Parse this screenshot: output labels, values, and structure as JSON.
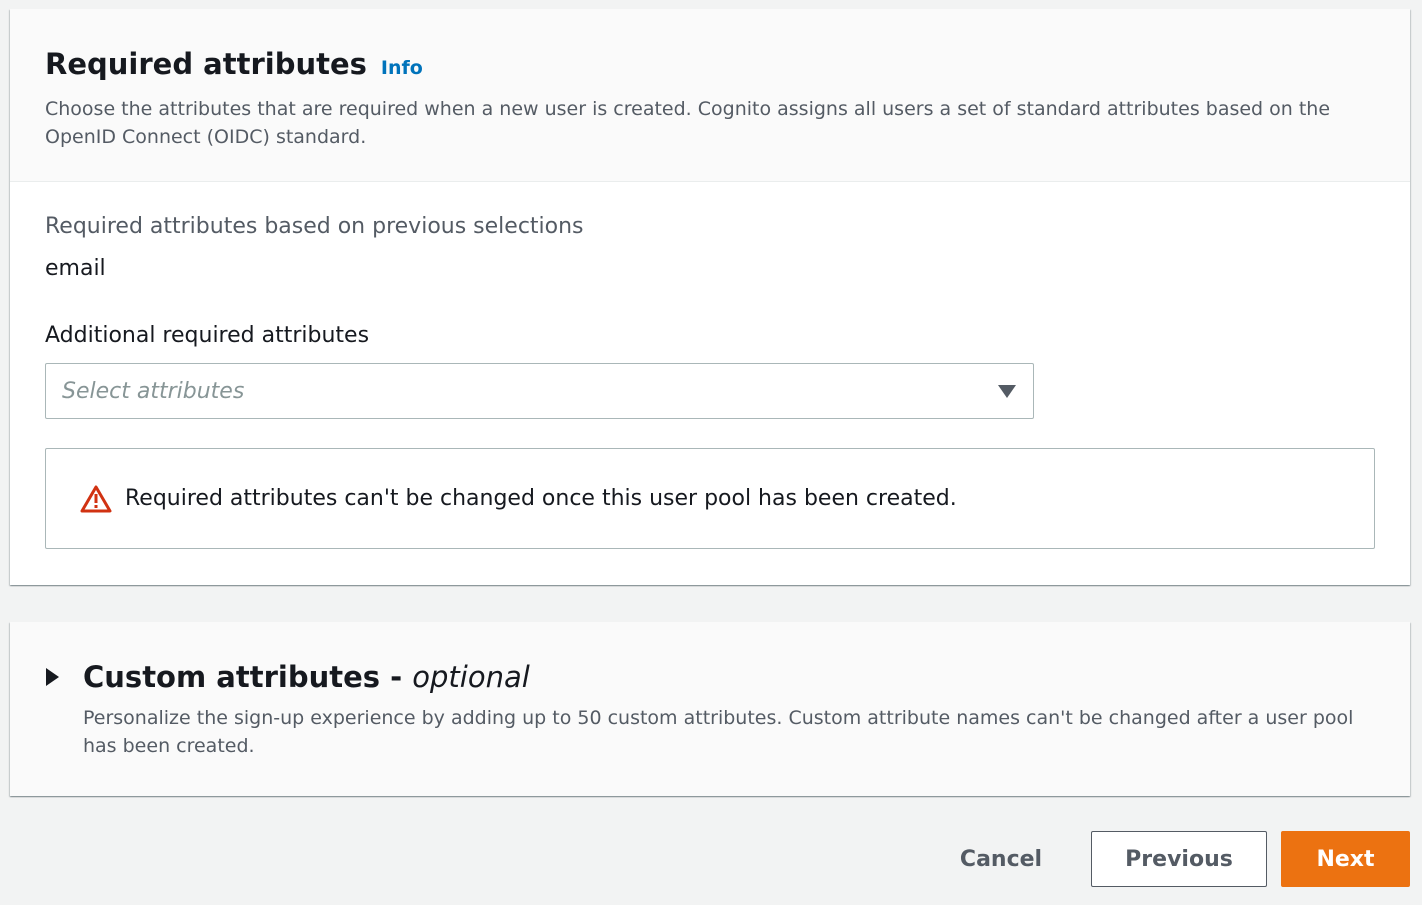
{
  "required_section": {
    "title": "Required attributes",
    "info_label": "Info",
    "description": "Choose the attributes that are required when a new user is created. Cognito assigns all users a set of standard attributes based on the OpenID Connect (OIDC) standard.",
    "previous_selections_label": "Required attributes based on previous selections",
    "previous_selections_value": "email",
    "additional_label": "Additional required attributes",
    "select_placeholder": "Select attributes",
    "warning_text": "Required attributes can't be changed once this user pool has been created.",
    "warning_icon": "warning-triangle-icon",
    "warning_color": "#d13212"
  },
  "custom_section": {
    "title": "Custom attributes - ",
    "title_optional": "optional",
    "description": "Personalize the sign-up experience by adding up to 50 custom attributes. Custom attribute names can't be changed after a user pool has been created.",
    "expanded": false
  },
  "footer": {
    "cancel_label": "Cancel",
    "previous_label": "Previous",
    "next_label": "Next",
    "primary_color": "#ec7211",
    "link_color": "#0073bb"
  }
}
